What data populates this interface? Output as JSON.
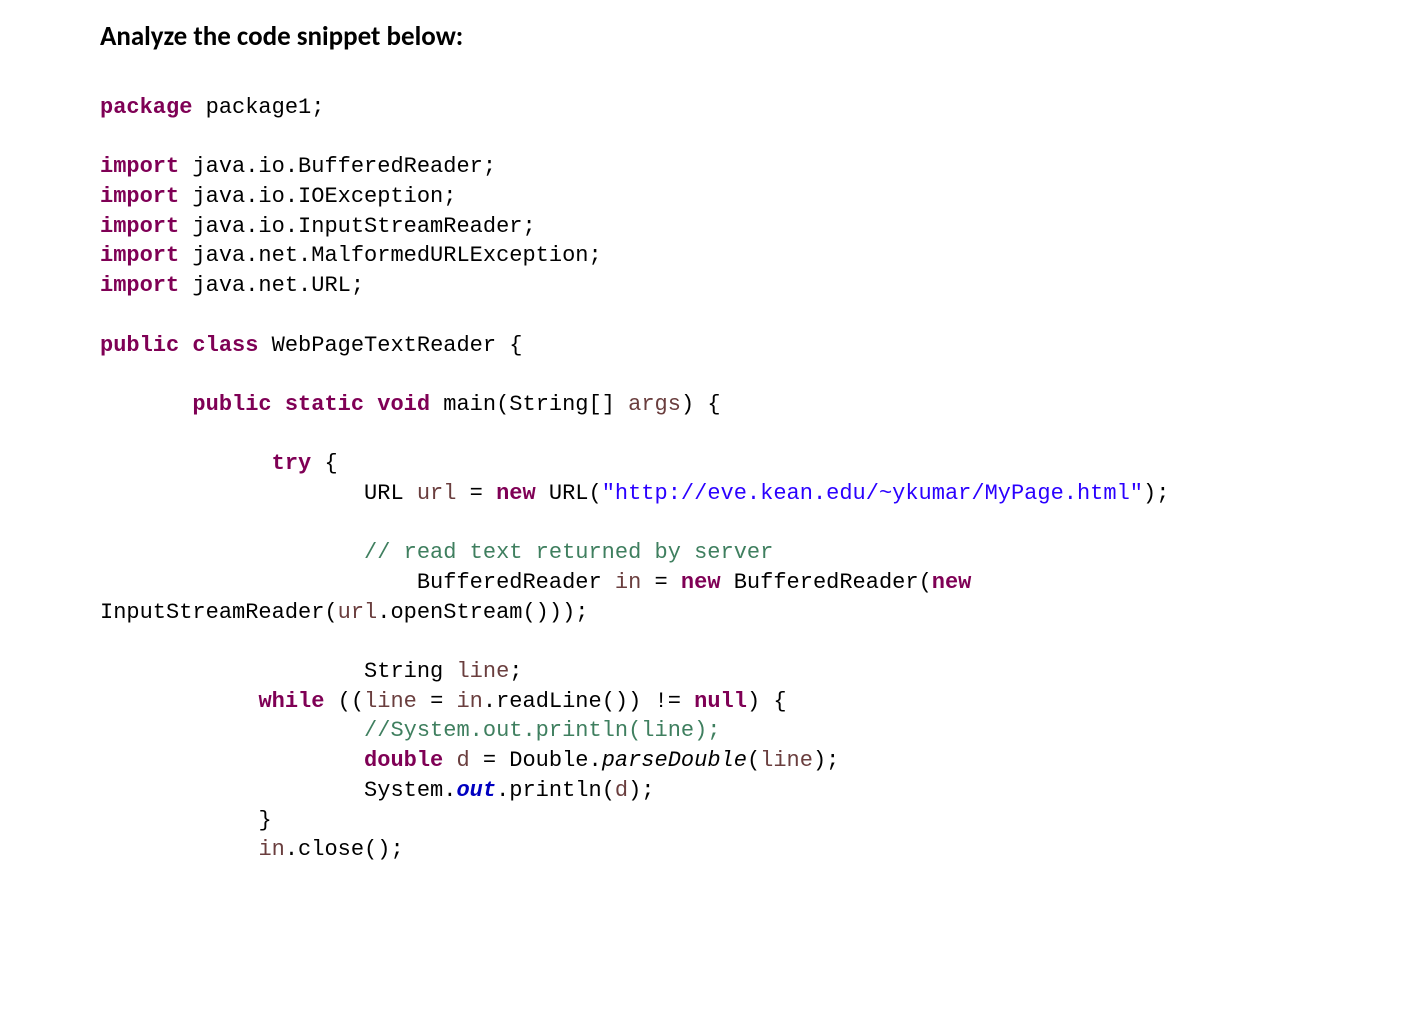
{
  "title": "Analyze the code snippet below:",
  "code": {
    "kw_package": "package",
    "pkg_name": " package1;",
    "kw_import": "import",
    "imp_1": " java.io.BufferedReader;",
    "imp_2": " java.io.IOException;",
    "imp_3": " java.io.InputStreamReader;",
    "imp_4": " java.net.MalformedURLException;",
    "imp_5": " java.net.URL;",
    "kw_public": "public",
    "kw_class": "class",
    "class_name": " WebPageTextReader {",
    "kw_static": "static",
    "kw_void": "void",
    "main_sig": " main(String[] ",
    "args_var": "args",
    "main_sig_end": ") {",
    "kw_try": "try",
    "try_open": " {",
    "url_decl_1": "URL ",
    "url_var": "url",
    "url_decl_2": " = ",
    "kw_new": "new",
    "url_decl_3": " URL(",
    "url_str": "\"http://eve.kean.edu/~ykumar/MyPage.html\"",
    "url_decl_4": ");",
    "cmt_read": "// read text returned by server",
    "buf_decl_1": "BufferedReader ",
    "in_var": "in",
    "buf_decl_2": " = ",
    "buf_decl_3": " BufferedReader(",
    "isr_wrap_start": "InputStreamReader(",
    "isr_wrap_end": ".openStream()));",
    "str_decl_1": "String ",
    "line_var": "line",
    "str_decl_end": ";",
    "kw_while": "while",
    "while_1": " ((",
    "while_2": " = ",
    "while_3": ".readLine()) != ",
    "kw_null": "null",
    "while_4": ") {",
    "cmt_sout": "//System.out.println(line);",
    "kw_double": "double",
    "dbl_space": " ",
    "d_var": "d",
    "dbl_2": " = Double.",
    "parseDouble": "parseDouble",
    "dbl_3": "(",
    "dbl_4": ");",
    "sout_1": "System.",
    "out_field": "out",
    "sout_2": ".println(",
    "sout_3": ");",
    "brace_close": "}",
    "in_close": ".close();"
  }
}
